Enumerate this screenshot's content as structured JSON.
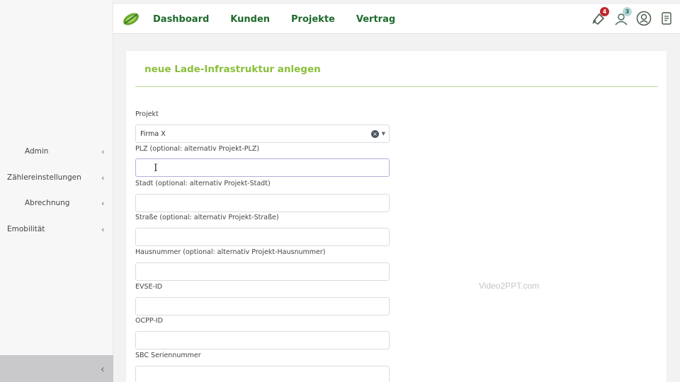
{
  "nav": {
    "items": [
      "Dashboard",
      "Kunden",
      "Projekte",
      "Vertrag"
    ],
    "color": "#1f6b2c"
  },
  "top_icons": [
    {
      "name": "notification-icon",
      "badge": "4",
      "badge_color": "#c0242a"
    },
    {
      "name": "messages-icon",
      "badge": "3",
      "badge_color": "#1c7a8a"
    },
    {
      "name": "user-icon"
    },
    {
      "name": "document-icon"
    }
  ],
  "sidebar": {
    "items": [
      {
        "label": "Admin",
        "chevron": "‹"
      },
      {
        "label": "Zählereinstellungen",
        "chevron": "‹"
      },
      {
        "label": "Abrechnung",
        "chevron": "‹"
      },
      {
        "label": "Emobilität",
        "chevron": "‹"
      }
    ],
    "collapse": "‹"
  },
  "form": {
    "title": "neue Lade-Infrastruktur anlegen",
    "accent": "#8bbf3b",
    "fields": [
      {
        "label": "Projekt",
        "value": "Firma X",
        "type": "select"
      },
      {
        "label": "PLZ (optional: alternativ Projekt-PLZ)",
        "value": ""
      },
      {
        "label": "Stadt (optional: alternativ Projekt-Stadt)",
        "value": ""
      },
      {
        "label": "Straße (optional: alternativ Projekt-Straße)",
        "value": ""
      },
      {
        "label": "Hausnummer (optional: alternativ Projekt-Hausnummer)",
        "value": ""
      },
      {
        "label": "EVSE-ID",
        "value": ""
      },
      {
        "label": "OCPP-ID",
        "value": ""
      },
      {
        "label": "SBC Seriennummer",
        "value": ""
      }
    ]
  },
  "watermark": "Video2PPT.com"
}
